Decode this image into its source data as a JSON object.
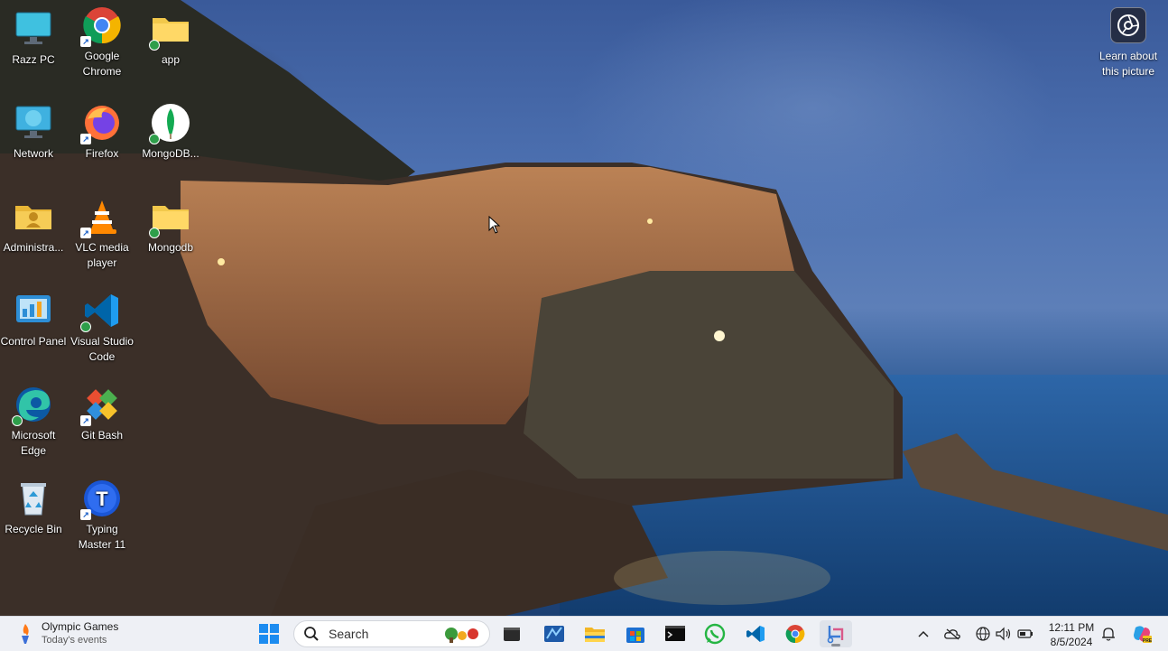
{
  "desktop": {
    "icons": [
      {
        "label": "Razz PC",
        "icon": "computer-icon"
      },
      {
        "label": "Google Chrome",
        "icon": "chrome-icon"
      },
      {
        "label": "app",
        "icon": "folder-icon"
      },
      {
        "label": "Network",
        "icon": "network-icon"
      },
      {
        "label": "Firefox",
        "icon": "firefox-icon"
      },
      {
        "label": "MongoDB...",
        "icon": "mongodb-icon"
      },
      {
        "label": "Administra...",
        "icon": "user-folder-icon"
      },
      {
        "label": "VLC media player",
        "icon": "vlc-icon"
      },
      {
        "label": "Mongodb",
        "icon": "folder-icon"
      },
      {
        "label": "Control Panel",
        "icon": "control-panel-icon"
      },
      {
        "label": "Visual Studio Code",
        "icon": "vscode-icon"
      },
      {
        "label": "Microsoft Edge",
        "icon": "edge-icon"
      },
      {
        "label": "Git Bash",
        "icon": "git-bash-icon"
      },
      {
        "label": "Recycle Bin",
        "icon": "recycle-bin-icon"
      },
      {
        "label": "Typing Master 11",
        "icon": "typing-master-icon"
      }
    ],
    "learn_about": "Learn about this picture"
  },
  "taskbar": {
    "news_title": "Olympic Games",
    "news_subtitle": "Today's events",
    "search_placeholder": "Search",
    "apps": [
      "start-icon",
      "widgets-icon",
      "terminal-icon",
      "snipping-tool-icon",
      "file-explorer-icon",
      "microsoft-store-icon",
      "command-prompt-icon",
      "whatsapp-icon",
      "vscode-icon",
      "chrome-icon",
      "snip-sketch-icon"
    ],
    "clock_time": "12:11 PM",
    "clock_date": "8/5/2024"
  },
  "colors": {
    "accent": "#0067c0",
    "taskbar_bg": "#eef0f5"
  }
}
